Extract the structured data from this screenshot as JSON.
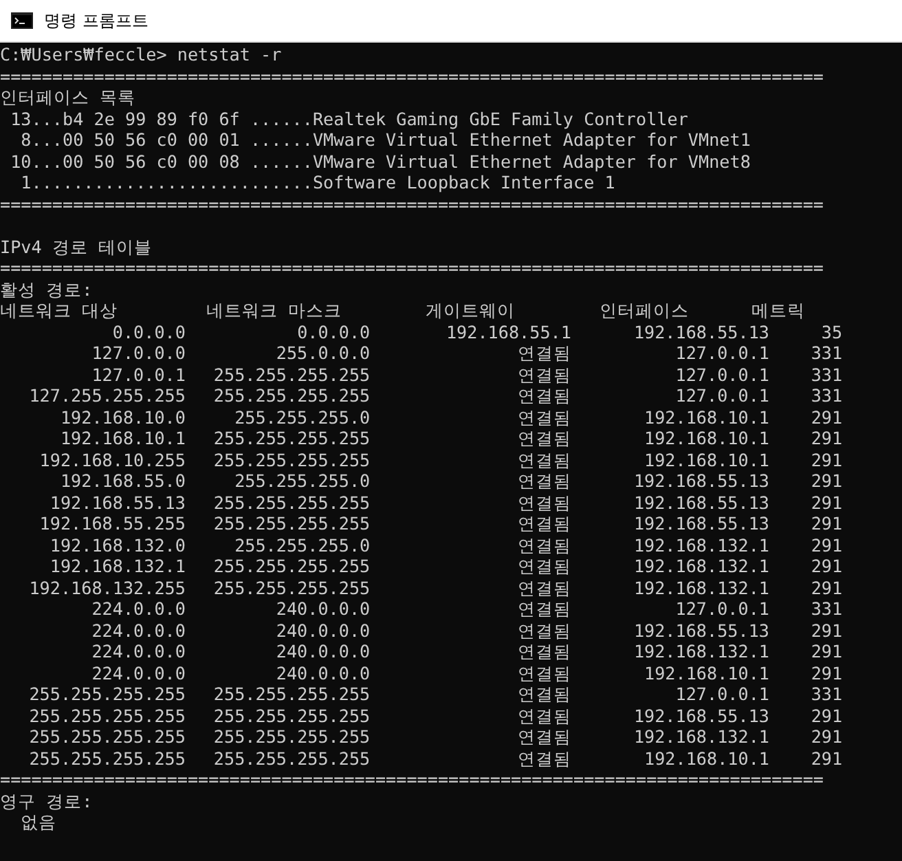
{
  "window": {
    "title": "명령 프롬프트"
  },
  "console": {
    "prompt": "C:₩Users₩feccle> netstat -r",
    "interface_list": {
      "rule_top": "===============================================================================",
      "heading": "인터페이스 목록",
      "entries": [
        " 13...b4 2e 99 89 f0 6f ......Realtek Gaming GbE Family Controller",
        "  8...00 50 56 c0 00 01 ......VMware Virtual Ethernet Adapter for VMnet1",
        " 10...00 50 56 c0 00 08 ......VMware Virtual Ethernet Adapter for VMnet8",
        "  1...........................Software Loopback Interface 1"
      ],
      "rule_bottom": "==============================================================================="
    },
    "ipv4_route_table": {
      "heading": "IPv4 경로 테이블",
      "rule": "===============================================================================",
      "active_routes": {
        "heading": "활성 경로:",
        "columns": [
          "네트워크 대상",
          "네트워크 마스크",
          "게이트웨이",
          "인터페이스",
          "메트릭"
        ],
        "rows": [
          {
            "destination": "0.0.0.0",
            "netmask": "0.0.0.0",
            "gateway": "192.168.55.1",
            "interface": "192.168.55.13",
            "metric": "35"
          },
          {
            "destination": "127.0.0.0",
            "netmask": "255.0.0.0",
            "gateway": "연결됨",
            "interface": "127.0.0.1",
            "metric": "331"
          },
          {
            "destination": "127.0.0.1",
            "netmask": "255.255.255.255",
            "gateway": "연결됨",
            "interface": "127.0.0.1",
            "metric": "331"
          },
          {
            "destination": "127.255.255.255",
            "netmask": "255.255.255.255",
            "gateway": "연결됨",
            "interface": "127.0.0.1",
            "metric": "331"
          },
          {
            "destination": "192.168.10.0",
            "netmask": "255.255.255.0",
            "gateway": "연결됨",
            "interface": "192.168.10.1",
            "metric": "291"
          },
          {
            "destination": "192.168.10.1",
            "netmask": "255.255.255.255",
            "gateway": "연결됨",
            "interface": "192.168.10.1",
            "metric": "291"
          },
          {
            "destination": "192.168.10.255",
            "netmask": "255.255.255.255",
            "gateway": "연결됨",
            "interface": "192.168.10.1",
            "metric": "291"
          },
          {
            "destination": "192.168.55.0",
            "netmask": "255.255.255.0",
            "gateway": "연결됨",
            "interface": "192.168.55.13",
            "metric": "291"
          },
          {
            "destination": "192.168.55.13",
            "netmask": "255.255.255.255",
            "gateway": "연결됨",
            "interface": "192.168.55.13",
            "metric": "291"
          },
          {
            "destination": "192.168.55.255",
            "netmask": "255.255.255.255",
            "gateway": "연결됨",
            "interface": "192.168.55.13",
            "metric": "291"
          },
          {
            "destination": "192.168.132.0",
            "netmask": "255.255.255.0",
            "gateway": "연결됨",
            "interface": "192.168.132.1",
            "metric": "291"
          },
          {
            "destination": "192.168.132.1",
            "netmask": "255.255.255.255",
            "gateway": "연결됨",
            "interface": "192.168.132.1",
            "metric": "291"
          },
          {
            "destination": "192.168.132.255",
            "netmask": "255.255.255.255",
            "gateway": "연결됨",
            "interface": "192.168.132.1",
            "metric": "291"
          },
          {
            "destination": "224.0.0.0",
            "netmask": "240.0.0.0",
            "gateway": "연결됨",
            "interface": "127.0.0.1",
            "metric": "331"
          },
          {
            "destination": "224.0.0.0",
            "netmask": "240.0.0.0",
            "gateway": "연결됨",
            "interface": "192.168.55.13",
            "metric": "291"
          },
          {
            "destination": "224.0.0.0",
            "netmask": "240.0.0.0",
            "gateway": "연결됨",
            "interface": "192.168.132.1",
            "metric": "291"
          },
          {
            "destination": "224.0.0.0",
            "netmask": "240.0.0.0",
            "gateway": "연결됨",
            "interface": "192.168.10.1",
            "metric": "291"
          },
          {
            "destination": "255.255.255.255",
            "netmask": "255.255.255.255",
            "gateway": "연결됨",
            "interface": "127.0.0.1",
            "metric": "331"
          },
          {
            "destination": "255.255.255.255",
            "netmask": "255.255.255.255",
            "gateway": "연결됨",
            "interface": "192.168.55.13",
            "metric": "291"
          },
          {
            "destination": "255.255.255.255",
            "netmask": "255.255.255.255",
            "gateway": "연결됨",
            "interface": "192.168.132.1",
            "metric": "291"
          },
          {
            "destination": "255.255.255.255",
            "netmask": "255.255.255.255",
            "gateway": "연결됨",
            "interface": "192.168.10.1",
            "metric": "291"
          }
        ],
        "rule": "==============================================================================="
      },
      "persistent_routes": {
        "heading": "영구 경로:",
        "value": "없음"
      }
    }
  }
}
